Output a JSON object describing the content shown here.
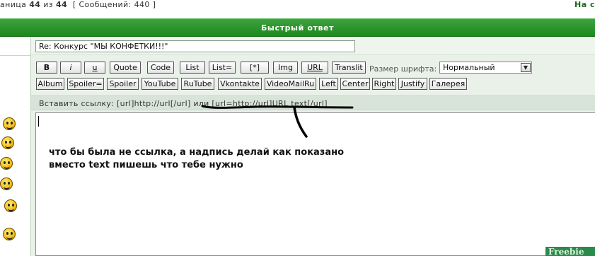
{
  "topbar": {
    "page_info_prefix": "аница",
    "page_current": "44",
    "page_of": "из",
    "page_total": "44",
    "messages": "[ Сообщений: 440 ]",
    "right_link": "На с"
  },
  "header": {
    "title": "Быстрый ответ"
  },
  "form": {
    "subject_value": "Re: Конкурс \"МЫ КОНФЕТКИ!!!\"",
    "font_label": "Размер шрифта:",
    "font_selected": "Нормальный",
    "hint": "Вставить ссылку: [url]http://url[/url] или [url=http://url]URL text[/url]",
    "note_line1": "что бы была не ссылка, а надпись делай как показано",
    "note_line2": "вместо text пишешь что тебе нужно"
  },
  "toolbar_row1": [
    "B",
    "i",
    "u",
    "Quote",
    "Code",
    "List",
    "List=",
    "[*]",
    "Img",
    "URL",
    "Translit"
  ],
  "toolbar_row2": [
    "Album",
    "Spoiler=",
    "Spoiler",
    "YouTube",
    "RuTube",
    "Vkontakte",
    "VideoMailRu",
    "Left",
    "Center",
    "Right",
    "Justify",
    "Галерея"
  ],
  "smileys": [
    "smile",
    "thumbs-up",
    "tongue",
    "wink",
    "thinking",
    "laugh"
  ],
  "watermark": "Freebie",
  "colors": {
    "header_green": "#1c8a1c",
    "panel_bg": "#e9f1e9",
    "hint_bg": "#d9e4d9"
  }
}
